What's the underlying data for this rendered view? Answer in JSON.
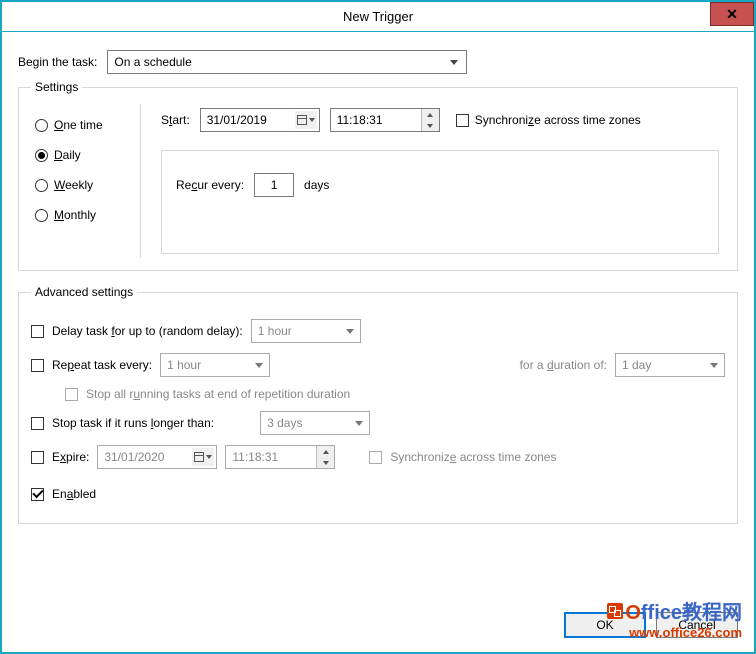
{
  "window": {
    "title": "New Trigger"
  },
  "begin": {
    "label": "Begin the task:",
    "value": "On a schedule"
  },
  "settings": {
    "legend": "Settings",
    "frequency": {
      "one_time": "One time",
      "daily": "Daily",
      "weekly": "Weekly",
      "monthly": "Monthly",
      "selected": "daily"
    },
    "start_label": "Start:",
    "start_date": "31/01/2019",
    "start_time": "11:18:31",
    "sync_tz_label": "Synchronize across time zones",
    "sync_tz_checked": false,
    "recur_label": "Recur every:",
    "recur_value": "1",
    "recur_unit": "days"
  },
  "advanced": {
    "legend": "Advanced settings",
    "delay_label": "Delay task for up to (random delay):",
    "delay_value": "1 hour",
    "repeat_label": "Repeat task every:",
    "repeat_value": "1 hour",
    "duration_label": "for a duration of:",
    "duration_value": "1 day",
    "stop_repetition_label": "Stop all running tasks at end of repetition duration",
    "stop_longer_label": "Stop task if it runs longer than:",
    "stop_longer_value": "3 days",
    "expire_label": "Expire:",
    "expire_date": "31/01/2020",
    "expire_time": "11:18:31",
    "expire_sync_label": "Synchronize across time zones",
    "enabled_label": "Enabled",
    "enabled_checked": true
  },
  "buttons": {
    "ok": "OK",
    "cancel": "Cancel"
  },
  "watermark": {
    "brand1a": "O",
    "brand1b": "ffice",
    "brand1c": "教程网",
    "url": "www.office26.com"
  }
}
